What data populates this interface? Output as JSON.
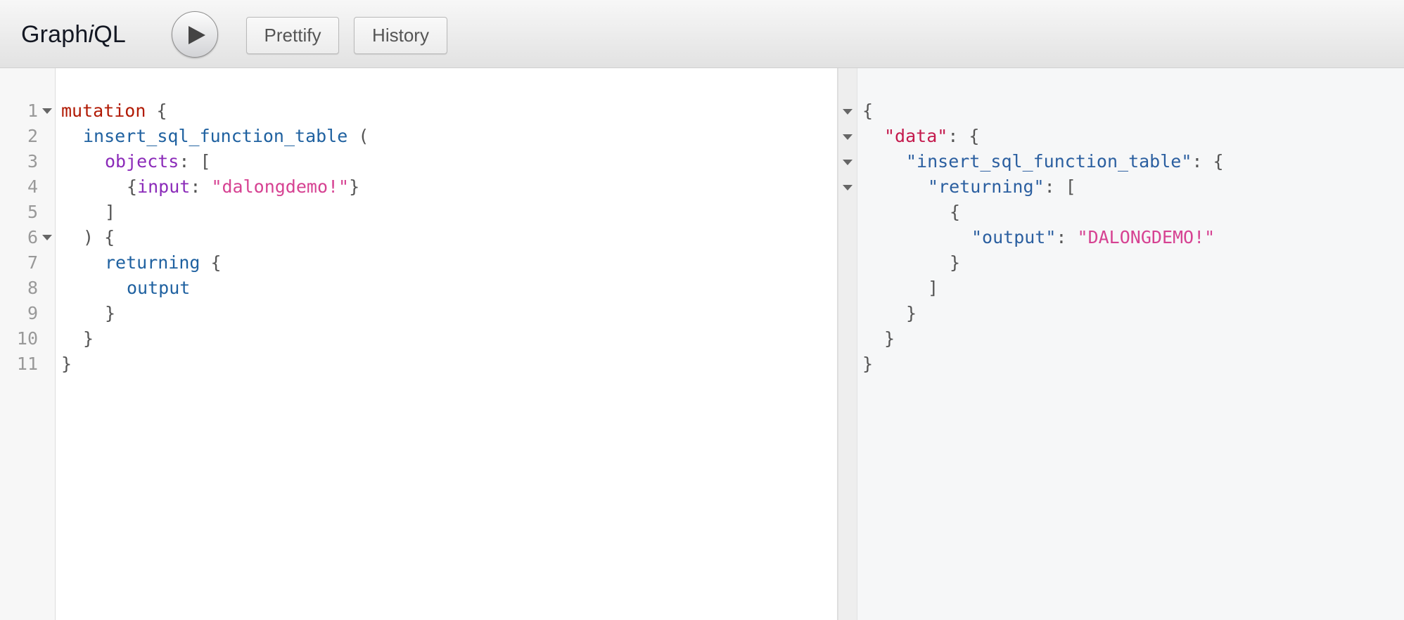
{
  "toolbar": {
    "title_prefix": "Graph",
    "title_italic": "i",
    "title_suffix": "QL",
    "prettify_label": "Prettify",
    "history_label": "History"
  },
  "query_editor": {
    "line_numbers": [
      "1",
      "2",
      "3",
      "4",
      "5",
      "6",
      "7",
      "8",
      "9",
      "10",
      "11"
    ],
    "lines": {
      "l1_kw": "mutation",
      "l1_p": " {",
      "l2_name": "insert_sql_function_table",
      "l2_p": " (",
      "l3_arg": "objects",
      "l3_p": ": [",
      "l4_open": "{",
      "l4_arg": "input",
      "l4_colon": ": ",
      "l4_str": "\"dalongdemo!\"",
      "l4_close": "}",
      "l5": "]",
      "l6": ") {",
      "l7_field": "returning",
      "l7_p": " {",
      "l8_field": "output",
      "l9": "}",
      "l10": "}",
      "l11": "}"
    }
  },
  "result_viewer": {
    "lines": {
      "r1": "{",
      "r2_key": "\"data\"",
      "r2_p": ": {",
      "r3_key": "\"insert_sql_function_table\"",
      "r3_p": ": {",
      "r4_key": "\"returning\"",
      "r4_p": ": [",
      "r5": "{",
      "r6_key": "\"output\"",
      "r6_colon": ": ",
      "r6_val": "\"DALONGDEMO!\"",
      "r7": "}",
      "r8": "]",
      "r9": "}",
      "r10": "}",
      "r11": "}"
    }
  },
  "colors": {
    "keyword": "#b11a04",
    "field": "#1f61a0",
    "argument": "#8b2bb9",
    "string": "#d64292",
    "json_key": "#c41a4d"
  },
  "icons": {
    "run": "play-icon",
    "fold": "fold-triangle-icon"
  }
}
